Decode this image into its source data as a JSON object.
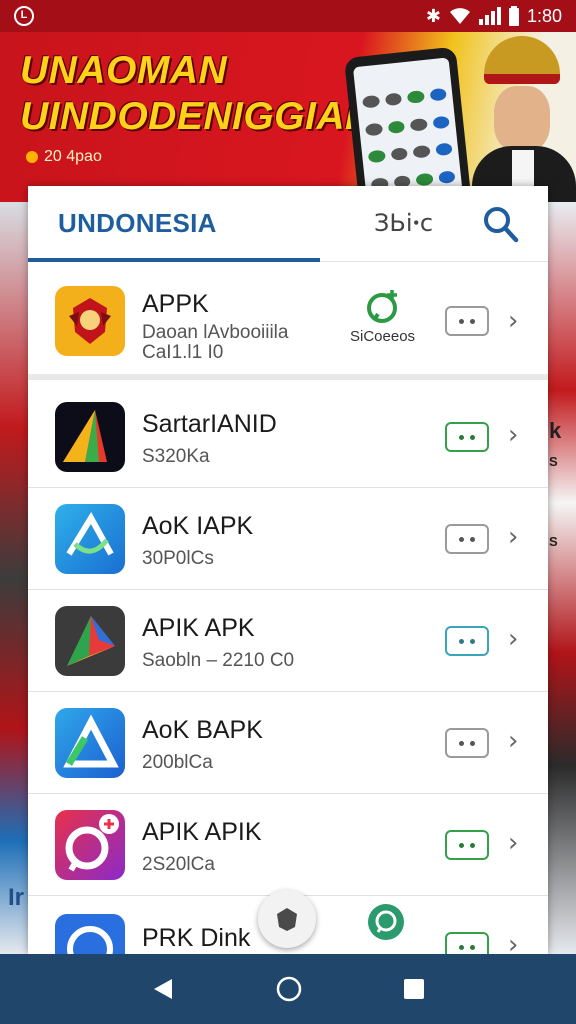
{
  "status_bar": {
    "time": "1:80",
    "left_badge": "L",
    "icons": [
      "notification-icon",
      "bluetooth-icon",
      "wifi-icon",
      "signal-icon",
      "battery-icon"
    ]
  },
  "banner": {
    "title_line1": "UNAOMAN",
    "title_line2": "UINDODENIGGIAI",
    "subtitle": "20 4pao"
  },
  "header": {
    "tab_title": "UNDONESIA",
    "lang_label": "ЗЬіꞏс"
  },
  "featured": {
    "name": "APPK",
    "meta1": "Daoan lAvbooiiila",
    "meta2": "CaI1.l1 I0",
    "share_label": "SiCoeeos"
  },
  "apps": [
    {
      "name": "SartarIANID",
      "meta": "S320Ka",
      "toggle": "green"
    },
    {
      "name": "AoK IAPK",
      "meta": "30P0lCs",
      "toggle": "gray"
    },
    {
      "name": "APIK APK",
      "meta": "Saobln – 2210 C0",
      "toggle": "teal"
    },
    {
      "name": "AoK BAPK",
      "meta": "200blCa",
      "toggle": "gray"
    },
    {
      "name": "APIK APIK",
      "meta": "2S20lCa",
      "toggle": "green"
    },
    {
      "name": "PRK Dink",
      "meta": "",
      "toggle": "green"
    }
  ],
  "side_text": {
    "right_k": "k",
    "right_s1": "S",
    "right_s2": "S",
    "left_in": "Ir"
  },
  "colors": {
    "brand_red": "#c8141c",
    "accent_blue": "#1f5e9e",
    "nav_bg": "#21466b",
    "toggle_green": "#35a04a",
    "toggle_teal": "#39a6b8"
  }
}
